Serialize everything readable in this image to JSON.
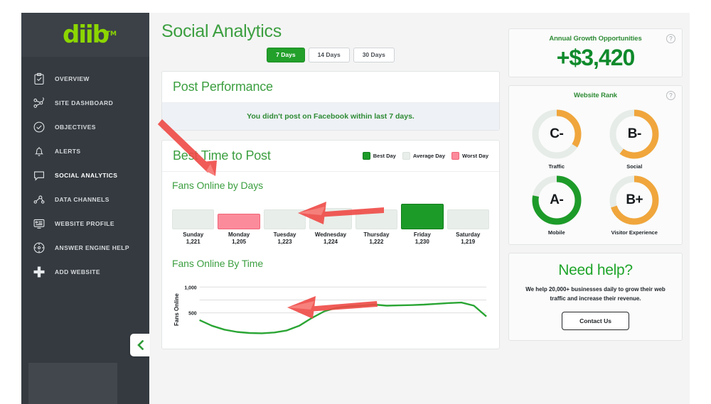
{
  "sidebar": {
    "logo": {
      "text": "diib",
      "tm": "TM"
    },
    "items": [
      {
        "label": "Overview",
        "icon": "clipboard-check-icon",
        "active": false
      },
      {
        "label": "Site Dashboard",
        "icon": "site-network-icon",
        "active": false
      },
      {
        "label": "Objectives",
        "icon": "check-circle-icon",
        "active": false
      },
      {
        "label": "Alerts",
        "icon": "bell-icon",
        "active": false
      },
      {
        "label": "Social Analytics",
        "icon": "chat-bubble-icon",
        "active": true
      },
      {
        "label": "Data Channels",
        "icon": "people-network-icon",
        "active": false
      },
      {
        "label": "Website Profile",
        "icon": "monitor-list-icon",
        "active": false
      },
      {
        "label": "Answer Engine Help",
        "icon": "compass-circle-icon",
        "active": false
      },
      {
        "label": "Add Website",
        "icon": "plus-icon",
        "active": false
      }
    ],
    "collapse_icon": "chevron-left-icon"
  },
  "header": {
    "title": "Social Analytics",
    "range_tabs": [
      {
        "label": "7 Days",
        "active": true
      },
      {
        "label": "14 Days",
        "active": false
      },
      {
        "label": "30 Days",
        "active": false
      }
    ]
  },
  "post_performance": {
    "title": "Post Performance",
    "notice": "You didn't post on Facebook within last 7 days."
  },
  "best_time": {
    "title": "Best Time to Post",
    "legend": [
      {
        "label": "Best Day",
        "color": "#1d9b29"
      },
      {
        "label": "Average Day",
        "color": "#e8eeea"
      },
      {
        "label": "Worst Day",
        "color": "#fb8b9b"
      }
    ],
    "days_section_title": "Fans Online by Days",
    "time_section_title": "Fans Online By Time"
  },
  "rail": {
    "growth": {
      "title": "Annual Growth Opportunities",
      "value": "+$3,420",
      "help_icon": "question-mark-icon"
    },
    "rank": {
      "title": "Website Rank",
      "help_icon": "question-mark-icon",
      "gauges": [
        {
          "label": "Traffic",
          "grade": "C-",
          "percent": 34,
          "color": "#f0a63c"
        },
        {
          "label": "Social",
          "grade": "B-",
          "percent": 60,
          "color": "#f0a63c"
        },
        {
          "label": "Mobile",
          "grade": "A-",
          "percent": 78,
          "color": "#1d9b29"
        },
        {
          "label": "Visitor Experience",
          "grade": "B+",
          "percent": 70,
          "color": "#f0a63c"
        }
      ]
    },
    "help": {
      "title": "Need help?",
      "text": "We help 20,000+ businesses daily to grow their web traffic and increase their revenue.",
      "button": "Contact Us"
    }
  },
  "chart_data": [
    {
      "type": "bar",
      "title": "Fans Online by Days",
      "xlabel": "",
      "ylabel": "Fans Online",
      "categories": [
        "Sunday",
        "Monday",
        "Tuesday",
        "Wednesday",
        "Thursday",
        "Friday",
        "Saturday"
      ],
      "values": [
        1221,
        1205,
        1223,
        1224,
        1222,
        1230,
        1219
      ],
      "value_labels": [
        "1,221",
        "1,205",
        "1,223",
        "1,224",
        "1,222",
        "1,230",
        "1,219"
      ],
      "bar_states": [
        "average",
        "worst",
        "average",
        "average",
        "average",
        "best",
        "average"
      ],
      "bar_colors": [
        "#e8eeea",
        "#fb8b9b",
        "#e8eeea",
        "#e8eeea",
        "#e8eeea",
        "#1d9b29",
        "#e8eeea"
      ],
      "legend": [
        "Best Day",
        "Average Day",
        "Worst Day"
      ],
      "legend_position": "top-right",
      "grid": false
    },
    {
      "type": "line",
      "title": "Fans Online By Time",
      "xlabel": "",
      "ylabel": "Fans Online",
      "ylim": [
        0,
        1100
      ],
      "yticks": [
        500,
        1000
      ],
      "ytick_labels": [
        "500",
        "1,000"
      ],
      "grid": true,
      "line_color": "#2aa534",
      "x": [
        0,
        1,
        2,
        3,
        4,
        5,
        6,
        7,
        8,
        9,
        10,
        11,
        12,
        13,
        14,
        15,
        16,
        17,
        18,
        19,
        20,
        21,
        22,
        23
      ],
      "values": [
        360,
        250,
        175,
        130,
        110,
        105,
        120,
        160,
        250,
        400,
        530,
        600,
        625,
        640,
        660,
        640,
        645,
        650,
        660,
        675,
        690,
        700,
        640,
        430
      ]
    }
  ],
  "annotations": {
    "arrows": [
      {
        "name": "arrow-to-best-time-card",
        "color": "#ef4a46"
      },
      {
        "name": "arrow-to-fans-online-by-days",
        "color": "#ef4a46"
      },
      {
        "name": "arrow-to-fans-online-by-time",
        "color": "#ef4a46"
      }
    ]
  }
}
